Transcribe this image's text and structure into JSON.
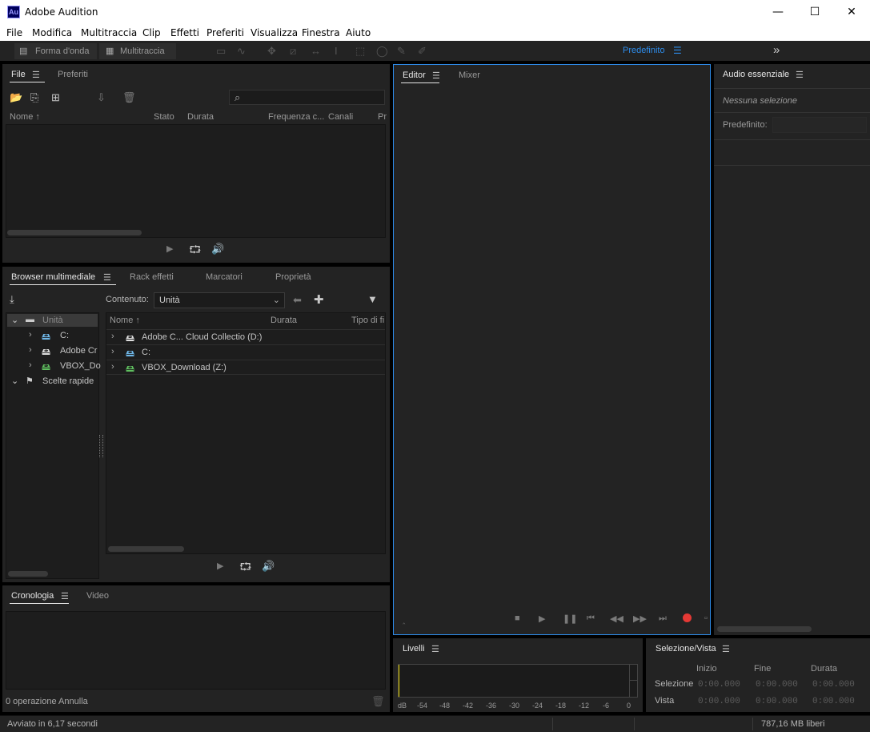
{
  "window": {
    "app_icon": "Au",
    "title": "Adobe Audition",
    "minimize": "—",
    "maximize": "☐",
    "close": "✕"
  },
  "menu": [
    "File",
    "Modifica",
    "Multitraccia",
    "Clip",
    "Effetti",
    "Preferiti",
    "Visualizza",
    "Finestra",
    "Aiuto"
  ],
  "toolbar": {
    "waveform": "Forma d'onda",
    "multitrack": "Multitraccia",
    "workspace": "Predefinito",
    "overflow": "»"
  },
  "file_panel": {
    "tabs": [
      "File",
      "Preferiti"
    ],
    "search_icon": "⌕",
    "columns": [
      "Nome ↑",
      "Stato",
      "Durata",
      "Frequenza c...",
      "Canali",
      "Pr"
    ]
  },
  "media_panel": {
    "tabs": [
      "Browser multimediale",
      "Rack effetti",
      "Marcatori",
      "Proprietà"
    ],
    "content_label": "Contenuto:",
    "content_value": "Unità",
    "tree": [
      "Unità",
      "C:",
      "Adobe Cr",
      "VBOX_Do",
      "Scelte rapide"
    ],
    "columns": [
      "Nome ↑",
      "Durata",
      "Tipo di fi"
    ],
    "rows": [
      "Adobe C... Cloud Collectio (D:)",
      "C:",
      "VBOX_Download (Z:)"
    ]
  },
  "history_panel": {
    "tabs": [
      "Cronologia",
      "Video"
    ],
    "status": "0 operazione Annulla"
  },
  "editor_panel": {
    "tabs": [
      "Editor",
      "Mixer"
    ]
  },
  "essential_panel": {
    "title": "Audio essenziale",
    "no_selection": "Nessuna selezione",
    "preset_label": "Predefinito:"
  },
  "levels_panel": {
    "title": "Livelli",
    "scale": [
      "dB",
      "-54",
      "-48",
      "-42",
      "-36",
      "-30",
      "-24",
      "-18",
      "-12",
      "-6",
      "0"
    ]
  },
  "selection_panel": {
    "title": "Selezione/Vista",
    "headers": [
      "Inizio",
      "Fine",
      "Durata"
    ],
    "rows": [
      {
        "label": "Selezione",
        "values": [
          "0:00.000",
          "0:00.000",
          "0:00.000"
        ]
      },
      {
        "label": "Vista",
        "values": [
          "0:00.000",
          "0:00.000",
          "0:00.000"
        ]
      }
    ]
  },
  "status_bar": {
    "left": "Avviato in 6,17 secondi",
    "right": "787,16 MB liberi"
  },
  "colors": {
    "accent": "#2d8ceb",
    "record": "#e53935",
    "panel": "#232323",
    "background": "#000000"
  }
}
